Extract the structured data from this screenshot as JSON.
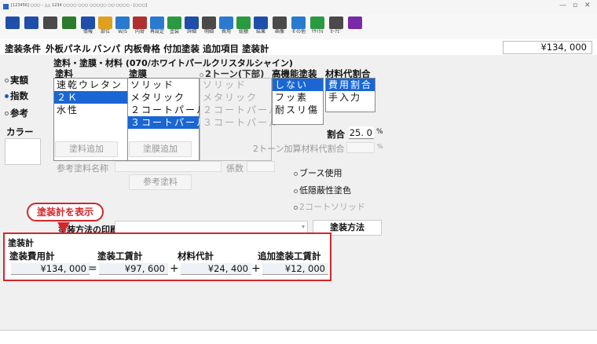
{
  "titlebar": {
    "title": "[123456] ○○○ - △△ 1234 ○○○○ ○○○ ○○○○○ ○○ ○○○○ - [○○○]"
  },
  "toolbar": {
    "buttons": [
      {
        "label": "",
        "icon": "save-icon",
        "color": "#1f4fa8"
      },
      {
        "label": "",
        "icon": "copy-icon",
        "color": "#1f4fa8"
      },
      {
        "label": "",
        "icon": "print-icon",
        "color": "#4a4a4a"
      },
      {
        "label": "",
        "icon": "pin-icon",
        "color": "#2c7a2c"
      },
      {
        "label": "情報",
        "icon": "info-icon",
        "color": "#1f4fa8"
      },
      {
        "label": "部位",
        "icon": "parts-icon",
        "color": "#e0a020"
      },
      {
        "label": "W/S",
        "icon": "windshield-icon",
        "color": "#2a7ad0"
      },
      {
        "label": "内骨",
        "icon": "frame-icon",
        "color": "#b03030"
      },
      {
        "label": "再設定",
        "icon": "reset-icon",
        "color": "#2a7ad0"
      },
      {
        "label": "塗装",
        "icon": "paint-icon",
        "color": "#2a9a40"
      },
      {
        "label": "詳細",
        "icon": "detail-icon",
        "color": "#1f4fa8"
      },
      {
        "label": "明細",
        "icon": "statement-icon",
        "color": "#4a4a4a"
      },
      {
        "label": "費用",
        "icon": "cost-icon",
        "color": "#2a7ad0"
      },
      {
        "label": "総額",
        "icon": "total-icon",
        "color": "#2a9a40"
      },
      {
        "label": "結果",
        "icon": "result-icon",
        "color": "#1f4fa8"
      },
      {
        "label": "画像",
        "icon": "image-icon",
        "color": "#4a4a4a"
      },
      {
        "label": "その他",
        "icon": "other-icon",
        "color": "#2a7ad0"
      },
      {
        "label": "ﾘｻｲｸﾙ",
        "icon": "recycle-icon",
        "color": "#2a9a40"
      },
      {
        "label": "ｶｰﾅﾋﾞ",
        "icon": "navi-icon",
        "color": "#4a4a4a"
      },
      {
        "label": "",
        "icon": "diamond-icon",
        "color": "#7a2aa8"
      }
    ]
  },
  "menu": {
    "items": [
      "塗装条件",
      "外板パネル",
      "バンパ",
      "内板骨格",
      "付加塗装",
      "追加項目",
      "塗装計"
    ],
    "total": "¥134, 000"
  },
  "left_tabs": {
    "items": [
      {
        "label": "実額",
        "active": false
      },
      {
        "label": "指数",
        "active": true
      },
      {
        "label": "参考",
        "active": false
      }
    ],
    "color_label": "カラー"
  },
  "paint": {
    "title": "塗料・塗膜・材料 (070/ホワイトパールクリスタルシャイン)",
    "col_paint": "塗料",
    "col_film": "塗膜",
    "col_two_tone": "2トーン(下部)",
    "col_hi_func": "高機能塗装",
    "col_material": "材料代割合",
    "paint_list": [
      {
        "label": "速乾ウレタン",
        "selected": false
      },
      {
        "label": "２Ｋ",
        "selected": true
      },
      {
        "label": "水性",
        "selected": false
      }
    ],
    "film_list": [
      {
        "label": "ソリッド",
        "selected": false
      },
      {
        "label": "メタリック",
        "selected": false
      },
      {
        "label": "２コートパール",
        "selected": false
      },
      {
        "label": "３コートパール",
        "selected": true
      }
    ],
    "two_tone_list": [
      {
        "label": "ソリッド",
        "selected": false
      },
      {
        "label": "メタリック",
        "selected": false
      },
      {
        "label": "２コートパール",
        "selected": false
      },
      {
        "label": "３コートパール",
        "selected": false
      }
    ],
    "hi_func_list": [
      {
        "label": "しない",
        "selected": true
      },
      {
        "label": "フッ素",
        "selected": false
      },
      {
        "label": "耐スリ傷",
        "selected": false
      }
    ],
    "material_list": [
      {
        "label": "費用割合",
        "selected": true
      },
      {
        "label": "手入力",
        "selected": false
      }
    ],
    "rate_label": "割合",
    "rate_value": "25. 0",
    "rate_unit": "%"
  },
  "controls": {
    "add_paint": "塗料追加",
    "add_film": "塗膜追加",
    "two_tone_rate": "2トーン加算材料代割合",
    "two_tone_unit": "%",
    "ref_paint_name": "参考塗料名称",
    "coefficient": "係数",
    "ref_paint": "参考塗料",
    "booth": "ブース使用",
    "low_hiding": "低隠蔽性塗色",
    "two_coat_solid": "2コートソリッド"
  },
  "print": {
    "label": "塗装方法の印刷",
    "method_button": "塗装方法"
  },
  "callout": {
    "text": "塗装計を表示"
  },
  "totals": {
    "title": "塗装計",
    "cost_label": "塗装費用計",
    "labor_label": "塗装工賃計",
    "material_label": "材料代計",
    "extra_label": "追加塗装工賃計",
    "cost_value": "¥134, 000",
    "labor_value": "¥97, 600",
    "material_value": "¥24, 400",
    "extra_value": "¥12, 000",
    "op_eq": "=",
    "op_plus1": "+",
    "op_plus2": "+"
  }
}
